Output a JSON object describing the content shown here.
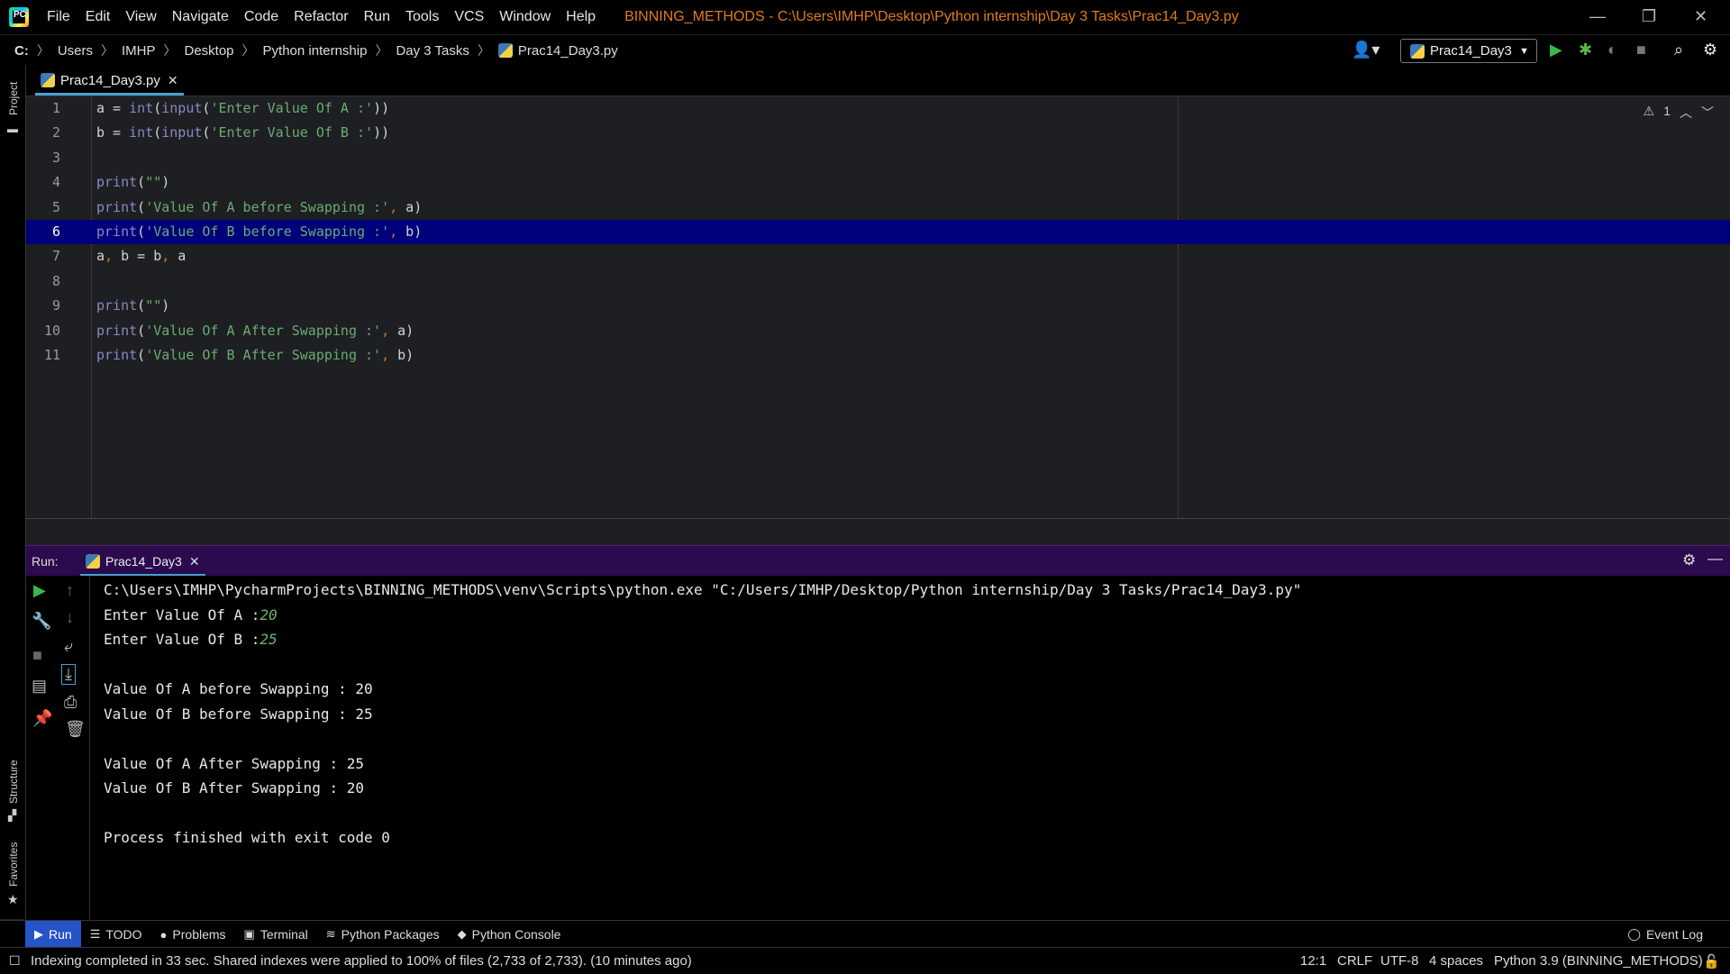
{
  "menubar": {
    "items": [
      "File",
      "Edit",
      "View",
      "Navigate",
      "Code",
      "Refactor",
      "Run",
      "Tools",
      "VCS",
      "Window",
      "Help"
    ],
    "window_title": "BINNING_METHODS - C:\\Users\\IMHP\\Desktop\\Python internship\\Day 3 Tasks\\Prac14_Day3.py"
  },
  "navbar": {
    "crumbs": [
      "C:",
      "Users",
      "IMHP",
      "Desktop",
      "Python internship",
      "Day 3 Tasks",
      "Prac14_Day3.py"
    ],
    "run_config": "Prac14_Day3"
  },
  "side_labels": {
    "project": "Project",
    "structure": "Structure",
    "favorites": "Favorites"
  },
  "editor": {
    "tab": "Prac14_Day3.py",
    "warning_count": "1",
    "highlighted_line": 6,
    "lines": [
      "a = int(input('Enter Value Of A :'))",
      "b = int(input('Enter Value Of B :'))",
      "",
      "print(\"\")",
      "print('Value Of A before Swapping :', a)",
      "print('Value Of B before Swapping :', b)",
      "a, b = b, a",
      "",
      "print(\"\")",
      "print('Value Of A After Swapping :', a)",
      "print('Value Of B After Swapping :', b)"
    ]
  },
  "run_panel": {
    "label": "Run:",
    "tab": "Prac14_Day3",
    "output": [
      {
        "text": "C:\\Users\\IMHP\\PycharmProjects\\BINNING_METHODS\\venv\\Scripts\\python.exe \"C:/Users/IMHP/Desktop/Python internship/Day 3 Tasks/Prac14_Day3.py\"",
        "input": ""
      },
      {
        "text": "Enter Value Of A :",
        "input": "20"
      },
      {
        "text": "Enter Value Of B :",
        "input": "25"
      },
      {
        "text": "",
        "input": ""
      },
      {
        "text": "Value Of A before Swapping : 20",
        "input": ""
      },
      {
        "text": "Value Of B before Swapping : 25",
        "input": ""
      },
      {
        "text": "",
        "input": ""
      },
      {
        "text": "Value Of A After Swapping : 25",
        "input": ""
      },
      {
        "text": "Value Of B After Swapping : 20",
        "input": ""
      },
      {
        "text": "",
        "input": ""
      },
      {
        "text": "Process finished with exit code 0",
        "input": ""
      }
    ]
  },
  "bottom_tools": [
    {
      "label": "Run",
      "icon": "play-icon",
      "active": true
    },
    {
      "label": "TODO",
      "icon": "list-icon",
      "active": false
    },
    {
      "label": "Problems",
      "icon": "info-icon",
      "active": false
    },
    {
      "label": "Terminal",
      "icon": "terminal-icon",
      "active": false
    },
    {
      "label": "Python Packages",
      "icon": "layers-icon",
      "active": false
    },
    {
      "label": "Python Console",
      "icon": "python-icon",
      "active": false
    }
  ],
  "event_log": "Event Log",
  "status": {
    "message": "Indexing completed in 33 sec. Shared indexes were applied to 100% of files (2,733 of 2,733). (10 minutes ago)",
    "position": "12:1",
    "line_sep": "CRLF",
    "encoding": "UTF-8",
    "indent": "4 spaces",
    "interpreter": "Python 3.9 (BINNING_METHODS)"
  },
  "colors": {
    "accent_blue": "#2553c8",
    "run_header": "#2b0a4d",
    "title_orange": "#e07b1a",
    "line_highlight": "#00007a"
  }
}
